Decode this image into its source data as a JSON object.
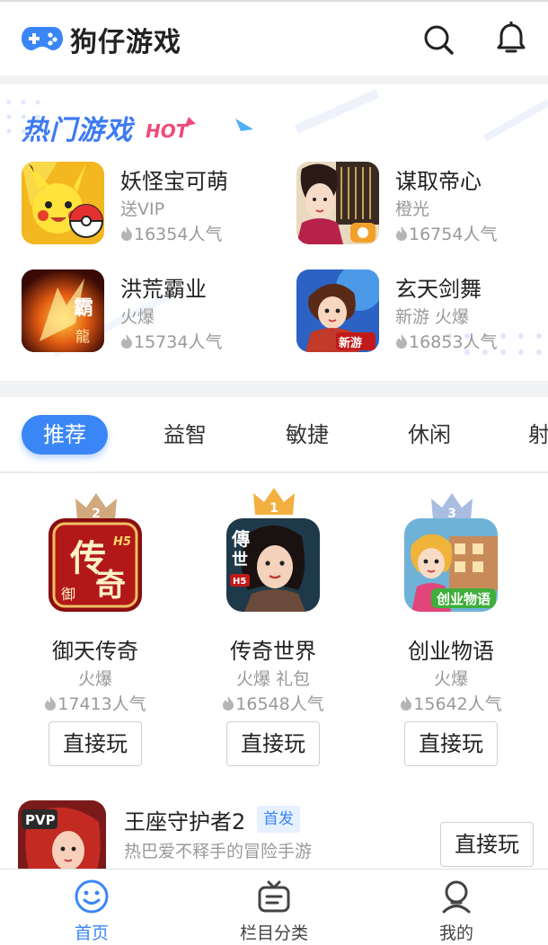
{
  "app": {
    "title": "狗仔游戏"
  },
  "hot": {
    "title": "热门游戏",
    "tag": "HOT",
    "games": [
      {
        "name": "妖怪宝可萌",
        "tag": "送VIP",
        "popularity": "16354人气"
      },
      {
        "name": "谋取帝心",
        "tag": "橙光",
        "popularity": "16754人气"
      },
      {
        "name": "洪荒霸业",
        "tag": "火爆",
        "popularity": "15734人气"
      },
      {
        "name": "玄天剑舞",
        "tag": "新游 火爆",
        "popularity": "16853人气"
      }
    ]
  },
  "tabs": [
    "推荐",
    "益智",
    "敏捷",
    "休闲",
    "射"
  ],
  "ranking": [
    {
      "rank": "2",
      "name": "御天传奇",
      "tag": "火爆",
      "popularity": "17413人气",
      "button": "直接玩"
    },
    {
      "rank": "1",
      "name": "传奇世界",
      "tag": "火爆 礼包",
      "popularity": "16548人气",
      "button": "直接玩"
    },
    {
      "rank": "3",
      "name": "创业物语",
      "tag": "火爆",
      "popularity": "15642人气",
      "button": "直接玩"
    }
  ],
  "list": [
    {
      "name": "王座守护者2",
      "badge": "首发",
      "desc": "热巴爱不释手的冒险手游",
      "button": "直接玩"
    }
  ],
  "nav": [
    {
      "label": "首页",
      "icon": "smile-icon"
    },
    {
      "label": "栏目分类",
      "icon": "category-icon"
    },
    {
      "label": "我的",
      "icon": "user-icon"
    }
  ],
  "colors": {
    "accent": "#3b86f7",
    "hot": "#f04a7a",
    "gold": "#f3b040",
    "silver": "#c9a47a",
    "bronze": "#a9bde0"
  }
}
